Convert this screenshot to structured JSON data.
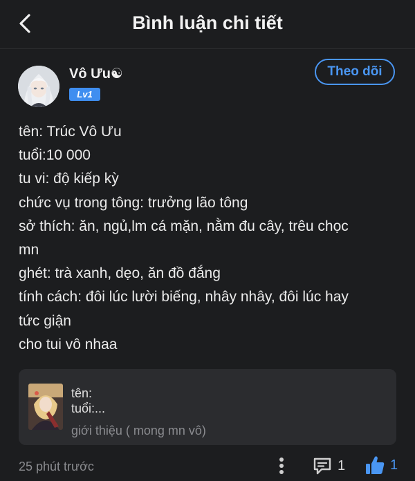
{
  "header": {
    "title": "Bình luận chi tiết",
    "back_icon": "chevron-left-icon"
  },
  "post": {
    "author": "Vô Ưu☯",
    "level": "Lv1",
    "follow_label": "Theo dõi",
    "body_lines": [
      "tên: Trúc Vô Ưu",
      "tuổi:10 000",
      "tu vi: độ kiếp kỳ",
      "chức vụ trong tông: trưởng lão tông",
      "sở thích: ăn, ngủ,lm cá mặn, nằm đu cây, trêu chọc",
      "mn",
      "ghét: trà xanh, dẹo, ăn đồ đắng",
      "tính cách: đôi lúc lười biếng, nhây nhây, đôi lúc hay",
      "tức giận",
      "cho tui vô nhaa"
    ]
  },
  "quote": {
    "line1": "tên:",
    "line2": "tuổi:...",
    "intro": "giới thiệu ( mong mn vô)"
  },
  "footer": {
    "timestamp": "25 phút trước",
    "comment_count": "1",
    "like_count": "1"
  },
  "colors": {
    "background": "#1c1d1f",
    "accent": "#4a96f2",
    "card": "#2b2c2f",
    "muted_text": "#8a8b8f"
  }
}
